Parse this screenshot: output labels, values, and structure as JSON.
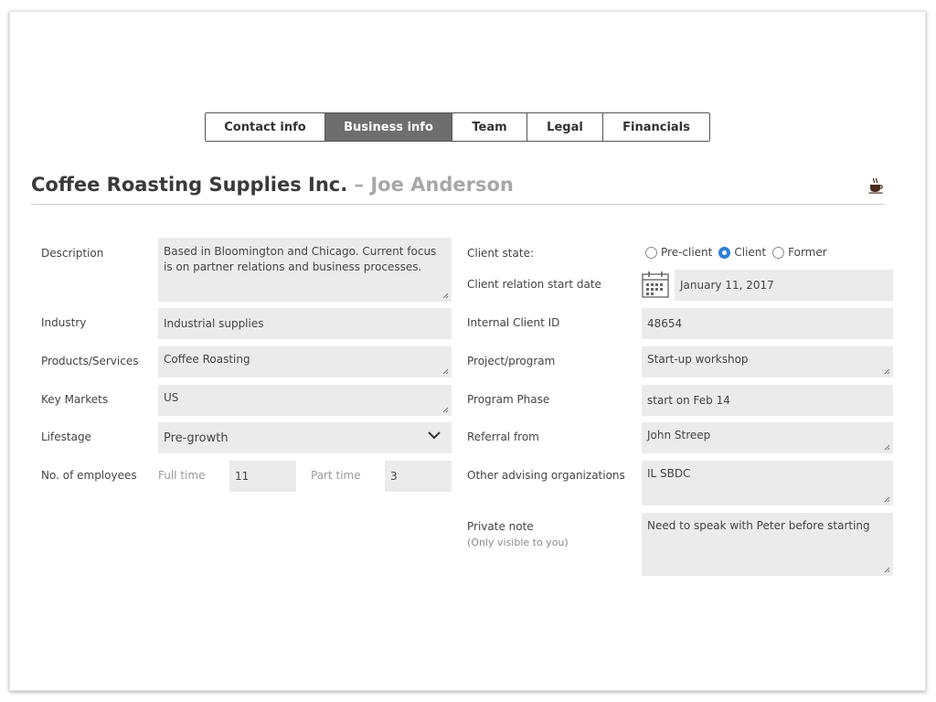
{
  "tabs": [
    {
      "label": "Contact info",
      "active": false
    },
    {
      "label": "Business info",
      "active": true
    },
    {
      "label": "Team",
      "active": false
    },
    {
      "label": "Legal",
      "active": false
    },
    {
      "label": "Financials",
      "active": false
    }
  ],
  "header": {
    "company": "Coffee Roasting Supplies Inc.",
    "separator": "–",
    "person": "Joe Anderson",
    "icon": "coffee-cup-icon"
  },
  "left": {
    "description": {
      "label": "Description",
      "value": "Based in Bloomington and Chicago. Current focus is on partner relations and business processes."
    },
    "industry": {
      "label": "Industry",
      "value": "Industrial supplies"
    },
    "products": {
      "label": "Products/Services",
      "value": "Coffee Roasting"
    },
    "markets": {
      "label": "Key Markets",
      "value": "US"
    },
    "lifestage": {
      "label": "Lifestage",
      "value": "Pre-growth"
    },
    "employees": {
      "label": "No. of employees",
      "full_time_label": "Full time",
      "full_time": "11",
      "part_time_label": "Part time",
      "part_time": "3"
    }
  },
  "right": {
    "client_state": {
      "label": "Client state:",
      "options": [
        {
          "label": "Pre-client",
          "checked": false
        },
        {
          "label": "Client",
          "checked": true
        },
        {
          "label": "Former",
          "checked": false
        }
      ]
    },
    "start_date": {
      "label": "Client relation start date",
      "value": "January 11, 2017"
    },
    "client_id": {
      "label": "Internal Client ID",
      "value": "48654"
    },
    "project": {
      "label": "Project/program",
      "value": "Start-up workshop"
    },
    "phase": {
      "label": "Program Phase",
      "value": "start on Feb 14"
    },
    "referral": {
      "label": "Referral from",
      "value": "John Streep"
    },
    "advising": {
      "label": "Other advising organizations",
      "value": "IL SBDC"
    },
    "private_note": {
      "label": "Private note",
      "sublabel": "(Only visible to you)",
      "value": "Need to speak with Peter before starting"
    }
  },
  "colors": {
    "active_tab": "#6e6e6e",
    "field_bg": "#ebebeb",
    "radio_checked": "#2f7fd6",
    "muted": "#a8a8a8"
  }
}
